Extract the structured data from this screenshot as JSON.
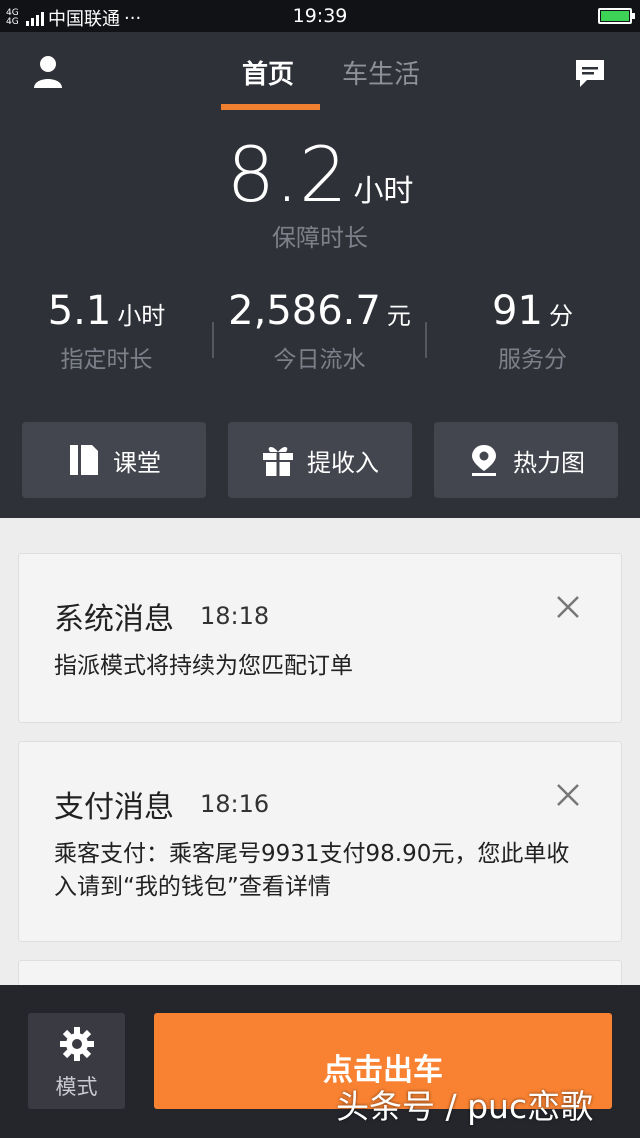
{
  "status_bar": {
    "network_type": "4G 4G",
    "carrier": "中国联通",
    "more": "···",
    "time": "19:39"
  },
  "header": {
    "tabs": [
      {
        "label": "首页",
        "active": true
      },
      {
        "label": "车生活",
        "active": false
      }
    ],
    "left_icon": "user-icon",
    "right_icon": "message-icon",
    "accent_color": "#f08030"
  },
  "dashboard": {
    "guaranteed_hours": {
      "value": "8.2",
      "unit": "小时",
      "label": "保障时长"
    },
    "stats": [
      {
        "value": "5.1",
        "unit": "小时",
        "label": "指定时长"
      },
      {
        "value": "2,586.7",
        "unit": "元",
        "label": "今日流水"
      },
      {
        "value": "91",
        "unit": "分",
        "label": "服务分"
      }
    ],
    "quick_actions": [
      {
        "label": "课堂",
        "icon": "book-icon"
      },
      {
        "label": "提收入",
        "icon": "gift-icon"
      },
      {
        "label": "热力图",
        "icon": "map-pin-icon"
      }
    ]
  },
  "messages": [
    {
      "title": "系统消息",
      "time": "18:18",
      "body": "指派模式将持续为您匹配订单"
    },
    {
      "title": "支付消息",
      "time": "18:16",
      "body": "乘客支付：乘客尾号9931支付98.90元，您此单收入请到“我的钱包”查看详情"
    }
  ],
  "bottom_bar": {
    "mode_label": "模式",
    "mode_icon": "gear-icon",
    "start_label": "点击出车",
    "start_color": "#f98232"
  },
  "watermark": "头条号 / puc恋歌"
}
